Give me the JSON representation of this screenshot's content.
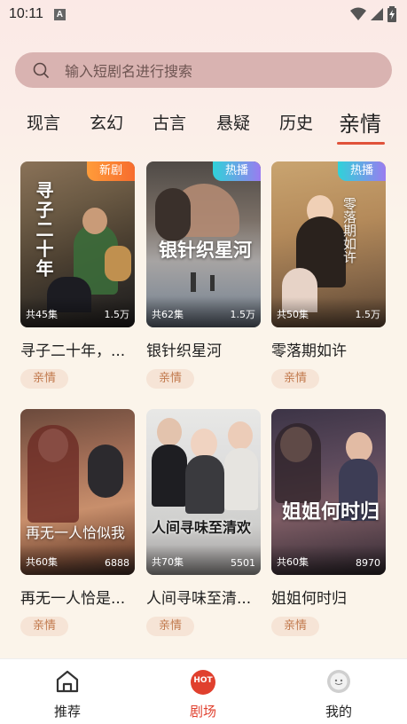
{
  "status": {
    "time": "10:11",
    "notify_glyph": "A"
  },
  "search": {
    "placeholder": "输入短剧名进行搜索"
  },
  "tabs": [
    {
      "label": "现言"
    },
    {
      "label": "玄幻"
    },
    {
      "label": "古言"
    },
    {
      "label": "悬疑"
    },
    {
      "label": "历史"
    },
    {
      "label": "亲情",
      "active": true
    }
  ],
  "dramas": [
    {
      "title": "寻子二十年，...",
      "badge": "新剧",
      "episodes": "共45集",
      "views": "1.5万",
      "tag": "亲情",
      "art": "寻子二十年"
    },
    {
      "title": "银针织星河",
      "badge": "热播",
      "episodes": "共62集",
      "views": "1.5万",
      "tag": "亲情",
      "art": "银针织星河"
    },
    {
      "title": "零落期如许",
      "badge": "热播",
      "episodes": "共50集",
      "views": "1.5万",
      "tag": "亲情",
      "art": "零落期如许"
    },
    {
      "title": "再无一人恰是...",
      "badge": "",
      "episodes": "共60集",
      "views": "6888",
      "tag": "亲情",
      "art": "再无一人恰似我"
    },
    {
      "title": "人间寻味至清...",
      "badge": "",
      "episodes": "共70集",
      "views": "5501",
      "tag": "亲情",
      "art": "人间寻味至清欢"
    },
    {
      "title": "姐姐何时归",
      "badge": "",
      "episodes": "共60集",
      "views": "8970",
      "tag": "亲情",
      "art": "姐姐何时归"
    }
  ],
  "nav": {
    "home": "推荐",
    "theater": "剧场",
    "hot_badge": "HOT",
    "profile": "我的"
  },
  "colors": {
    "accent": "#e0402e",
    "search_bg": "#d9b3b1",
    "tag_bg": "#f6e4d6",
    "tag_text": "#c27a4e"
  }
}
